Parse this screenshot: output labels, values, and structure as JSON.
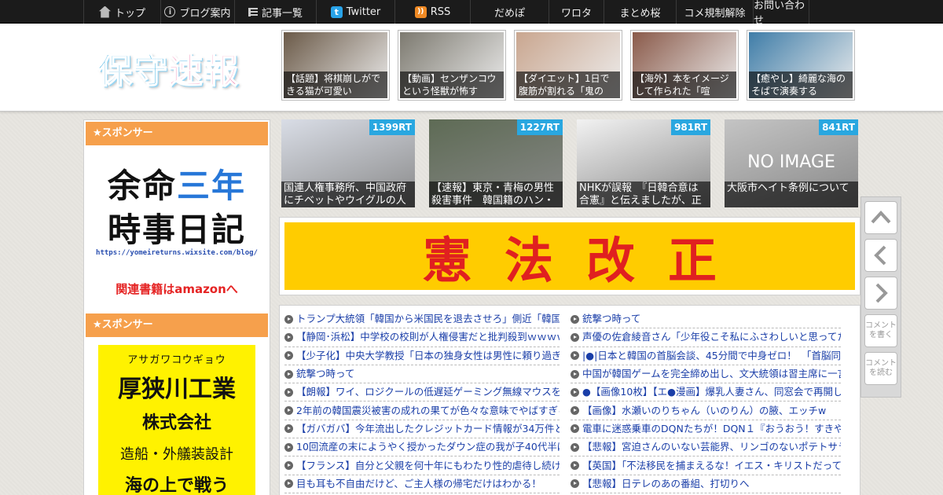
{
  "nav": {
    "items": [
      {
        "label": "トップ",
        "icon": "home-icon"
      },
      {
        "label": "ブログ案内",
        "icon": "info-icon"
      },
      {
        "label": "記事一覧",
        "icon": "list-icon"
      },
      {
        "label": "Twitter",
        "icon": "twitter-icon"
      },
      {
        "label": "RSS",
        "icon": "rss-icon"
      },
      {
        "label": "だめぽ"
      },
      {
        "label": "ワロタ"
      },
      {
        "label": "まとめ桜"
      },
      {
        "label": "コメ規制解除"
      },
      {
        "label": "お問い合わせ"
      }
    ]
  },
  "logo": {
    "text": "保守速報"
  },
  "header_thumbs": [
    {
      "caption": "【話題】将棋崩しができる猫が可愛い",
      "color": "#6b5a48"
    },
    {
      "caption": "【動画】センザンコウという怪獣が怖す",
      "color": "#7d7a70"
    },
    {
      "caption": "【ダイエット】1日で腹筋が割れる「鬼の",
      "color": "#c9a68f"
    },
    {
      "caption": "【海外】本をイメージして作られた「喧",
      "color": "#8a5a4a"
    },
    {
      "caption": "【癒やし】綺麗な海のそばで演奏する",
      "color": "#3f7da8"
    }
  ],
  "sidebar": {
    "sponsor_label_1": "★スポンサー",
    "ad1": {
      "line1_a": "余命",
      "line1_b": "三年",
      "line2": "時事日記",
      "url": "https://yomeireturns.wixsite.com/blog/",
      "link": "関連書籍はamazonへ"
    },
    "sponsor_label_2": "★スポンサー",
    "ad2": {
      "kana": "アサガワコウギョウ",
      "name": "厚狭川工業",
      "suffix": "株式会社",
      "desc": "造船・外艤装設計",
      "extra": "海の上で戦う"
    }
  },
  "rt_items": [
    {
      "badge": "1399RT",
      "caption": "国連人権事務所、中国政府にチベットやウイグルの人",
      "color": "#d9dde6"
    },
    {
      "badge": "1227RT",
      "caption": "【速報】東京・青梅の男性殺害事件　韓国籍のハン・",
      "color": "#5e6b55"
    },
    {
      "badge": "981RT",
      "caption": "NHKが誤報　『日韓合意は合憲』と伝えましたが、正",
      "color": "#f2f2f2"
    },
    {
      "badge": "841RT",
      "caption": "大阪市ヘイト条例について",
      "noimage": "NO IMAGE",
      "color": "#c4c4c4"
    }
  ],
  "banner": {
    "text": "憲法改正"
  },
  "list_left": [
    "トランプ大統領「韓国から米国民を退去させろ」側近「韓国の",
    "【静岡･浜松】中学校の校則が人権侵害だと批判殺到ｗｗｗｗ",
    "【少子化】中央大学教授「日本の独身女性は男性に頼り過ぎ」",
    "銃撃つ時って",
    "【朗報】ワイ、ロジクールの低遅延ゲーミング無線マウスを買",
    "2年前の韓国震災被害の成れの果てが色々な意味でやばすぎる",
    "【ガバガバ】今年流出したクレジットカード情報が34万件と去",
    "10回流産の末にようやく授かったダウン症の我が子40代半ば",
    "【フランス】自分と父親を何十年にもわたり性的虐待し続けた",
    "目も耳も不自由だけど、ご主人様の帰宅だけはわかる！"
  ],
  "list_right": [
    "銃撃つ時って",
    "声優の佐倉綾音さん「少年役こそ私にふさわしいと思ってた」",
    "|●|日本と韓国の首脳会談、45分間で中身ゼロ！　「首脳同士で",
    "中国が韓国ゲームを完全締め出し、文大統領は習主席に一言も",
    "●【画像10枚】【エ●漫画】爆乳人妻さん、同窓会で再開した同",
    "【画像】水瀬いのりちゃん（いのりん）の腋、エッチw",
    "電車に迷惑乗車のDQNたちが！DQN１『おうおう！すきや行こ",
    "【悲報】宮迫さんのいない芸能界、リンゴのないポテトサラダ",
    "【英国】「不法移民を捕まえるな！イエス・キリストだって難",
    "【悲報】日テレのあの番組、打切りへ"
  ],
  "float_buttons": {
    "up": "up-arrow-icon",
    "back": "left-arrow-icon",
    "forward": "right-arrow-icon",
    "write_comment": "コメントを書く",
    "read_comment": "コメントを読む"
  }
}
